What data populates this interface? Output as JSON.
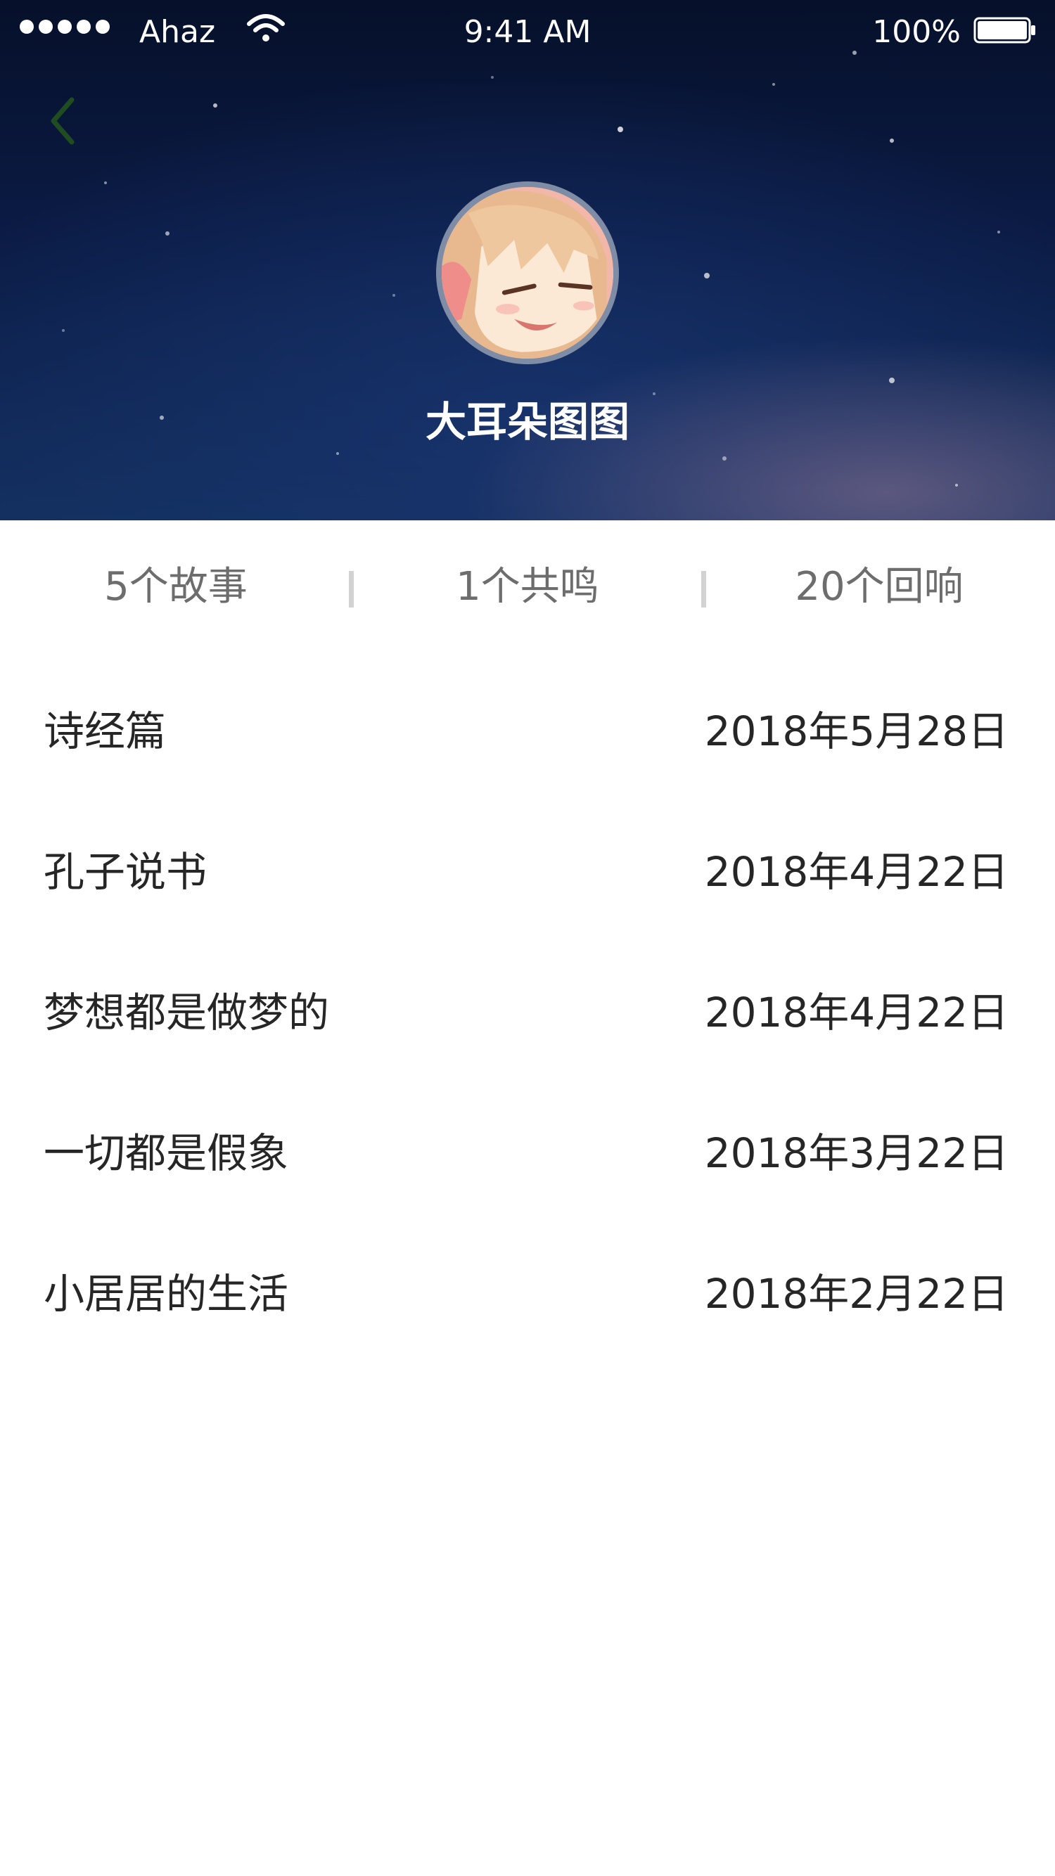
{
  "status_bar": {
    "carrier": "Ahaz",
    "time": "9:41 AM",
    "battery": "100%",
    "icons": [
      "signal-dots-icon",
      "wifi-icon",
      "battery-icon"
    ]
  },
  "header": {
    "back_icon": "chevron-left-icon",
    "back_color": "#1f4d1f",
    "avatar_icon": "anime-girl-avatar",
    "username": "大耳朵图图"
  },
  "stats": [
    {
      "label": "5个故事"
    },
    {
      "label": "1个共鸣"
    },
    {
      "label": "20个回响"
    }
  ],
  "stories": [
    {
      "title": "诗经篇",
      "date": "2018年5月28日"
    },
    {
      "title": "孔子说书",
      "date": "2018年4月22日"
    },
    {
      "title": "梦想都是做梦的",
      "date": "2018年4月22日"
    },
    {
      "title": "一切都是假象",
      "date": "2018年3月22日"
    },
    {
      "title": "小居居的生活",
      "date": "2018年2月22日"
    }
  ]
}
